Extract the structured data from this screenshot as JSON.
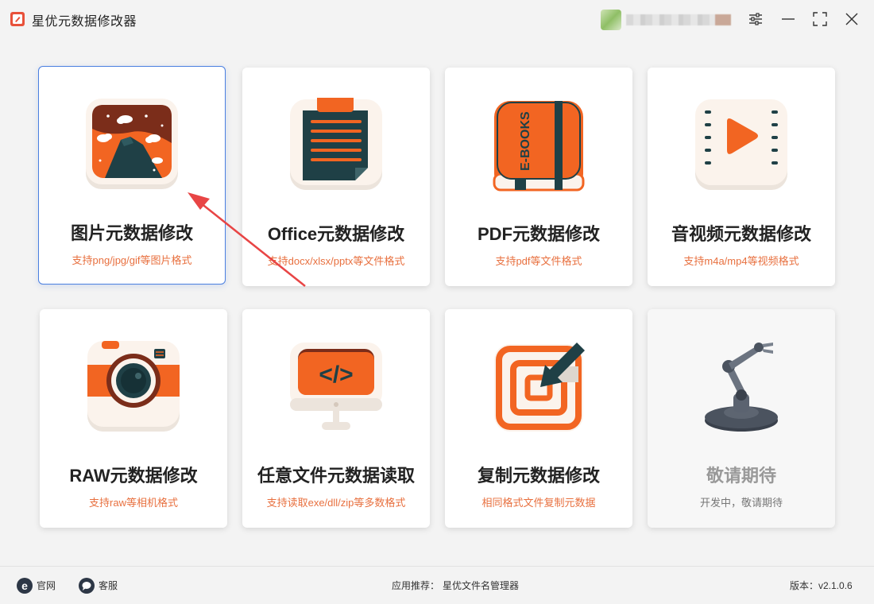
{
  "app": {
    "title": "星优元数据修改器"
  },
  "colors": {
    "accent": "#e8703f",
    "icon_orange": "#f26522",
    "icon_dark": "#1f4046",
    "selected_border": "#4a7fe0"
  },
  "window_controls": [
    {
      "name": "settings-icon"
    },
    {
      "name": "minimize-icon"
    },
    {
      "name": "maximize-icon"
    },
    {
      "name": "close-icon"
    }
  ],
  "cards": [
    {
      "title": "图片元数据修改",
      "subtitle": "支持png/jpg/gif等图片格式",
      "icon": "image-icon",
      "selected": true
    },
    {
      "title": "Office元数据修改",
      "subtitle": "支持docx/xlsx/pptx等文件格式",
      "icon": "document-icon"
    },
    {
      "title": "PDF元数据修改",
      "subtitle": "支持pdf等文件格式",
      "icon": "ebook-icon",
      "icon_text": "E-BOOKS"
    },
    {
      "title": "音视频元数据修改",
      "subtitle": "支持m4a/mp4等视频格式",
      "icon": "video-icon"
    },
    {
      "title": "RAW元数据修改",
      "subtitle": "支持raw等相机格式",
      "icon": "camera-icon"
    },
    {
      "title": "任意文件元数据读取",
      "subtitle": "支持读取exe/dll/zip等多数格式",
      "icon": "code-monitor-icon",
      "icon_text": "</>"
    },
    {
      "title": "复制元数据修改",
      "subtitle": "相同格式文件复制元数据",
      "icon": "copy-target-icon"
    },
    {
      "title": "敬请期待",
      "subtitle": "开发中，敬请期待",
      "icon": "robot-arm-icon",
      "disabled": true
    }
  ],
  "footer": {
    "website_label": "官网",
    "support_label": "客服",
    "recommend_label": "应用推荐：",
    "recommend_app": "星优文件名管理器",
    "version": "版本：v2.1.0.6"
  }
}
